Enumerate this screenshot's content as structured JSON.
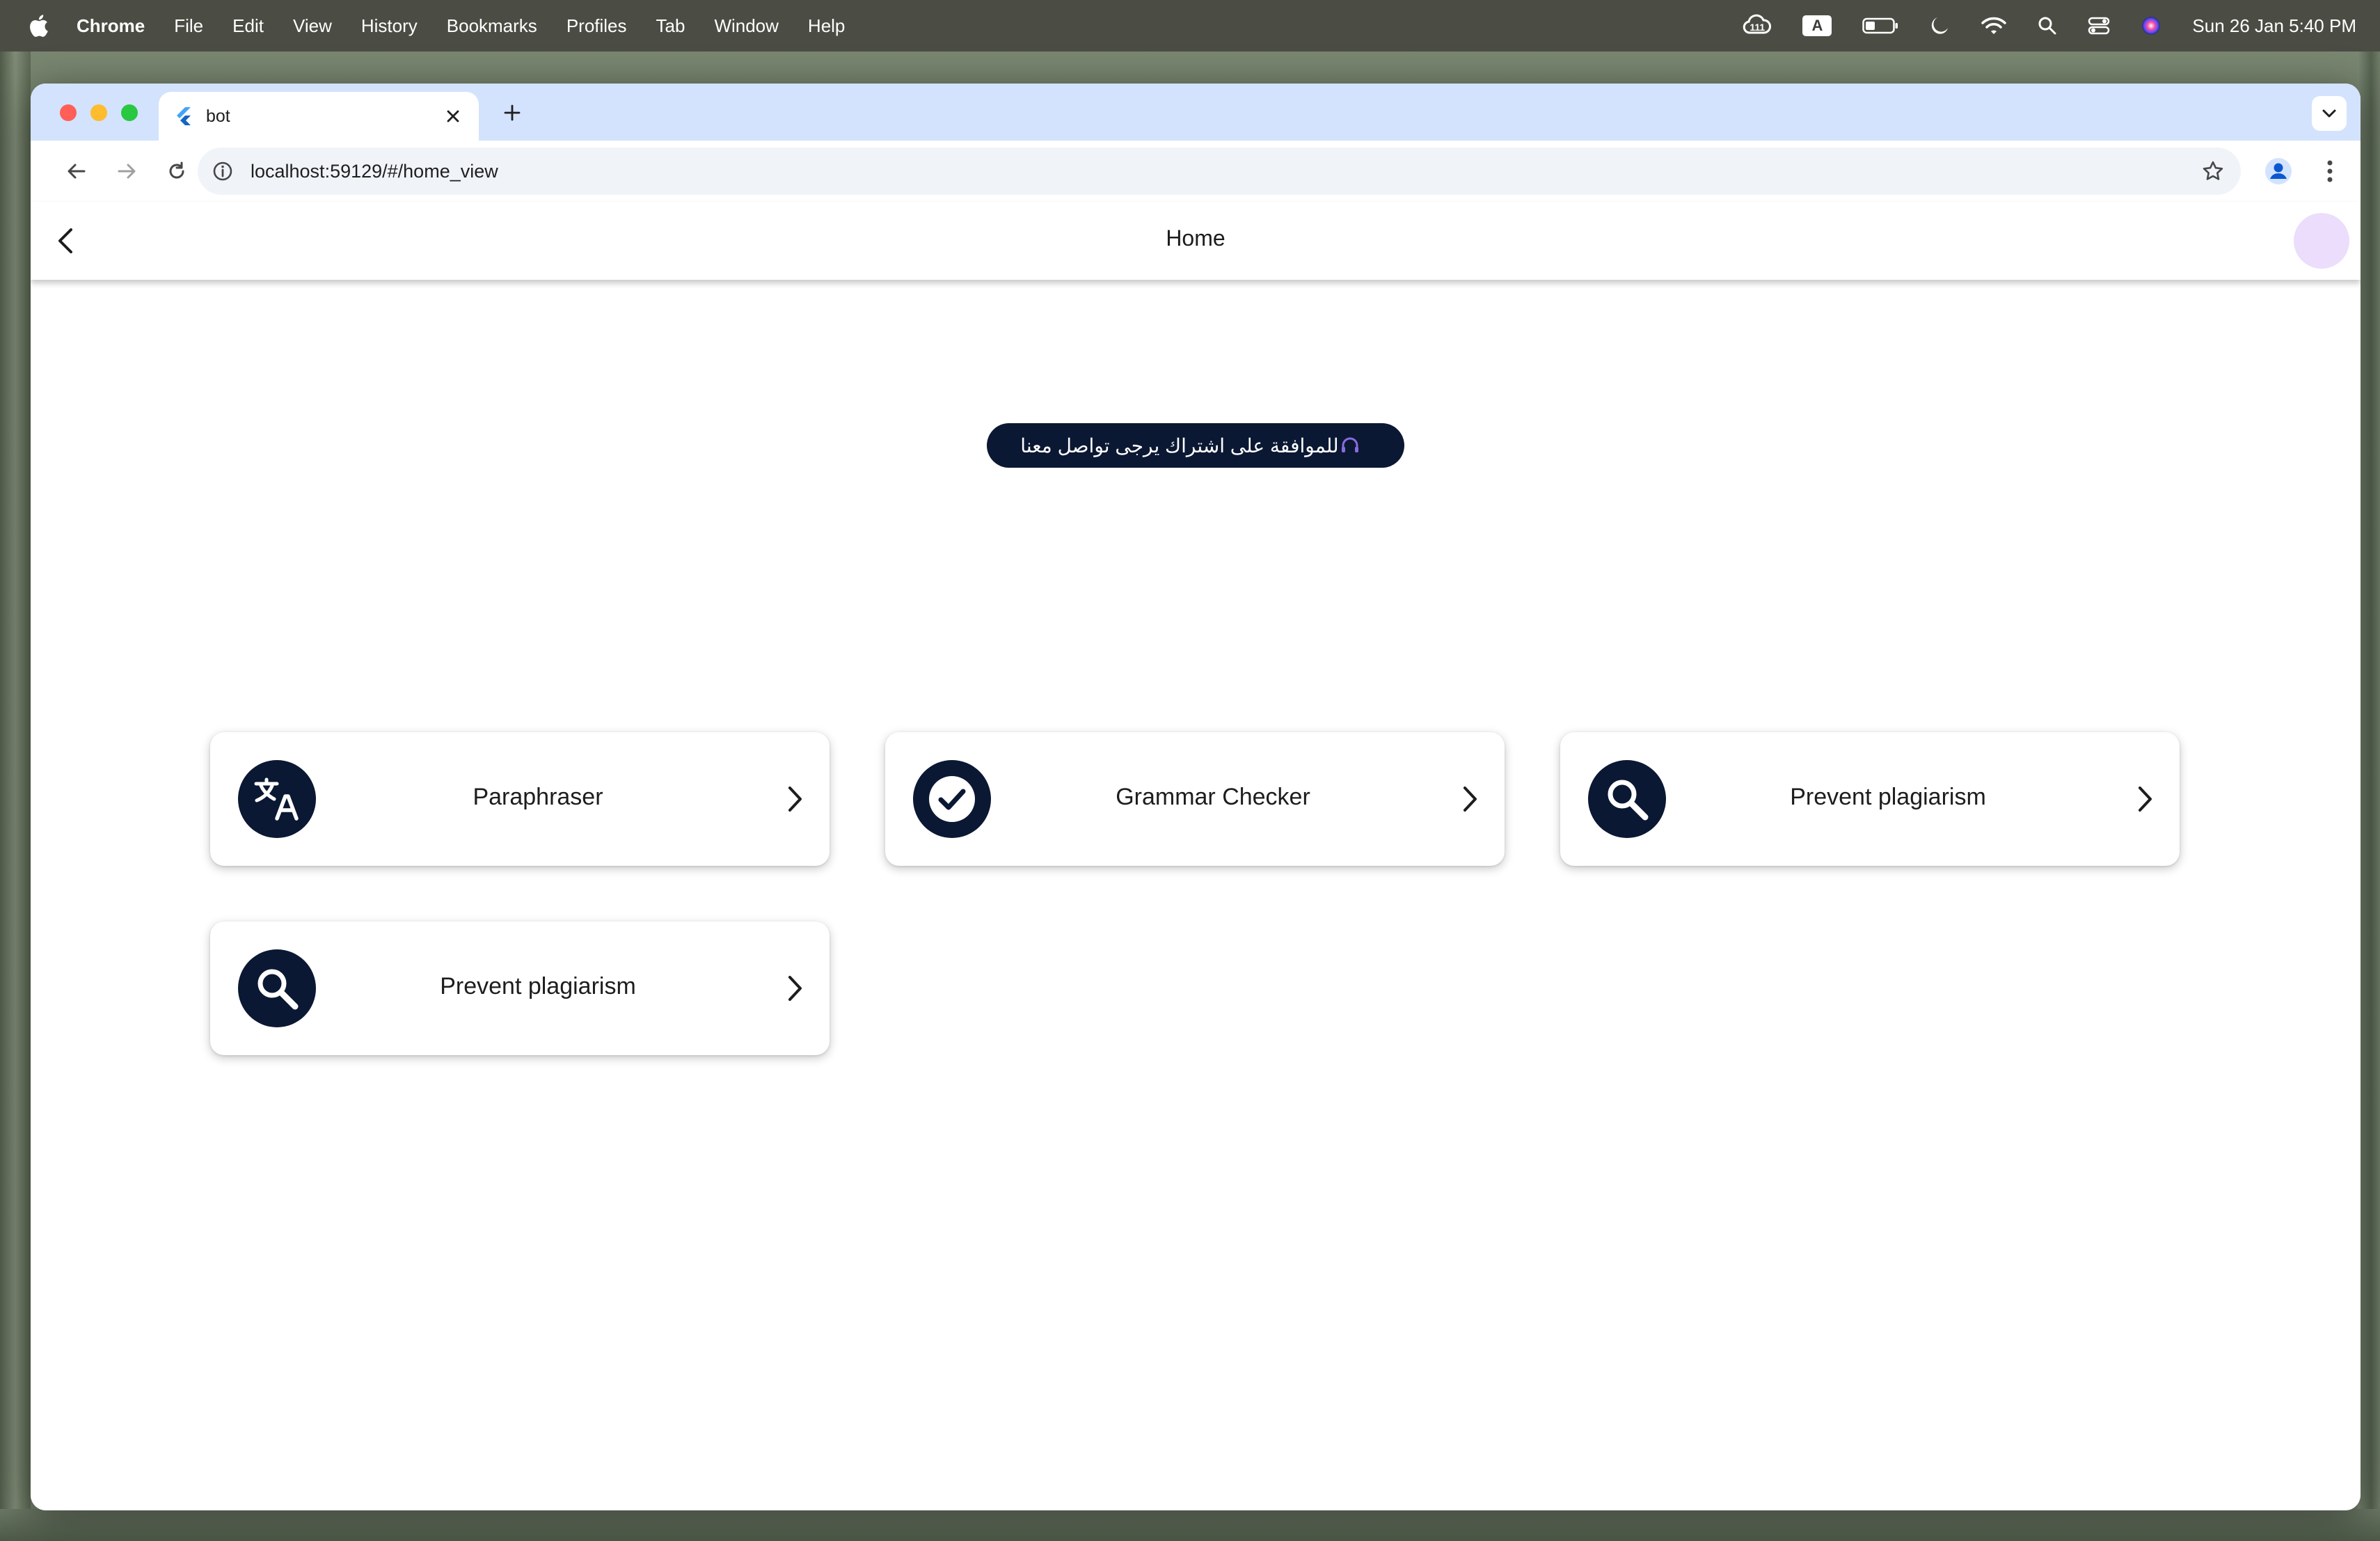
{
  "menubar": {
    "app": "Chrome",
    "items": [
      "File",
      "Edit",
      "View",
      "History",
      "Bookmarks",
      "Profiles",
      "Tab",
      "Window",
      "Help"
    ],
    "status_badge": "111",
    "input_source": "A",
    "datetime": "Sun 26 Jan  5:40 PM"
  },
  "browser": {
    "tab_title": "bot",
    "url": "localhost:59129/#/home_view"
  },
  "app": {
    "title": "Home",
    "banner_text": "للموافقة على اشتراك يرجى تواصل معنا",
    "cards": [
      {
        "label": "Paraphraser",
        "icon": "translate-icon"
      },
      {
        "label": "Grammar Checker",
        "icon": "check-circle-icon"
      },
      {
        "label": "Prevent plagiarism",
        "icon": "search-icon"
      },
      {
        "label": "Prevent plagiarism",
        "icon": "search-icon"
      }
    ]
  },
  "colors": {
    "accent_dark": "#0b1833",
    "tab_strip": "#d3e3fd",
    "avatar": "#ebddfb"
  }
}
